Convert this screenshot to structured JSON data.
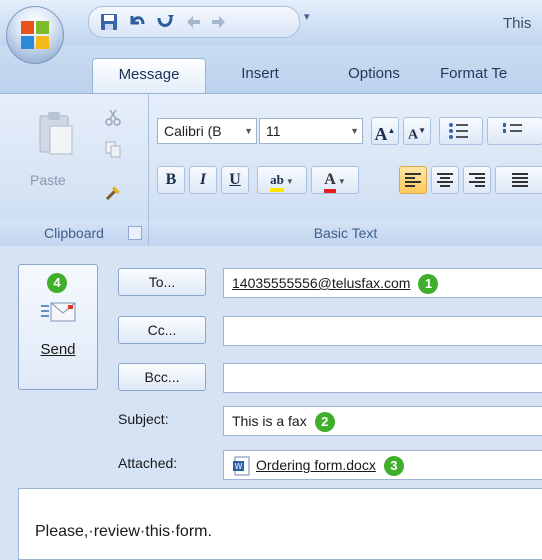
{
  "window": {
    "title": "This"
  },
  "qat": {
    "more_glyph": "▾"
  },
  "tabs": [
    {
      "label": "Message"
    },
    {
      "label": "Insert"
    },
    {
      "label": "Options"
    },
    {
      "label": "Format Te"
    }
  ],
  "ribbon": {
    "clipboard": {
      "label": "Clipboard",
      "paste_label": "Paste"
    },
    "basic_text": {
      "label": "Basic Text",
      "font_name": "Calibri (B",
      "font_size": "11",
      "bold": "B",
      "italic": "I",
      "underline": "U",
      "grow": "A",
      "shrink": "A",
      "highlight": "ab",
      "font_color": "A"
    }
  },
  "compose": {
    "send": {
      "label": "Send",
      "badge": "4"
    },
    "to": {
      "button": "To...",
      "value": "14035555556@telusfax.com",
      "badge": "1"
    },
    "cc": {
      "button": "Cc...",
      "value": ""
    },
    "bcc": {
      "button": "Bcc...",
      "value": ""
    },
    "subject": {
      "label": "Subject:",
      "value": "This is a fax",
      "badge": "2"
    },
    "attached": {
      "label": "Attached:",
      "file": "Ordering form.docx",
      "badge": "3"
    },
    "body": "Please,·review·this·form."
  },
  "colors": {
    "badge": "#3fae2a",
    "accent": "#1e395b",
    "highlight_yellow": "#ffe600",
    "font_red": "#e02020"
  }
}
